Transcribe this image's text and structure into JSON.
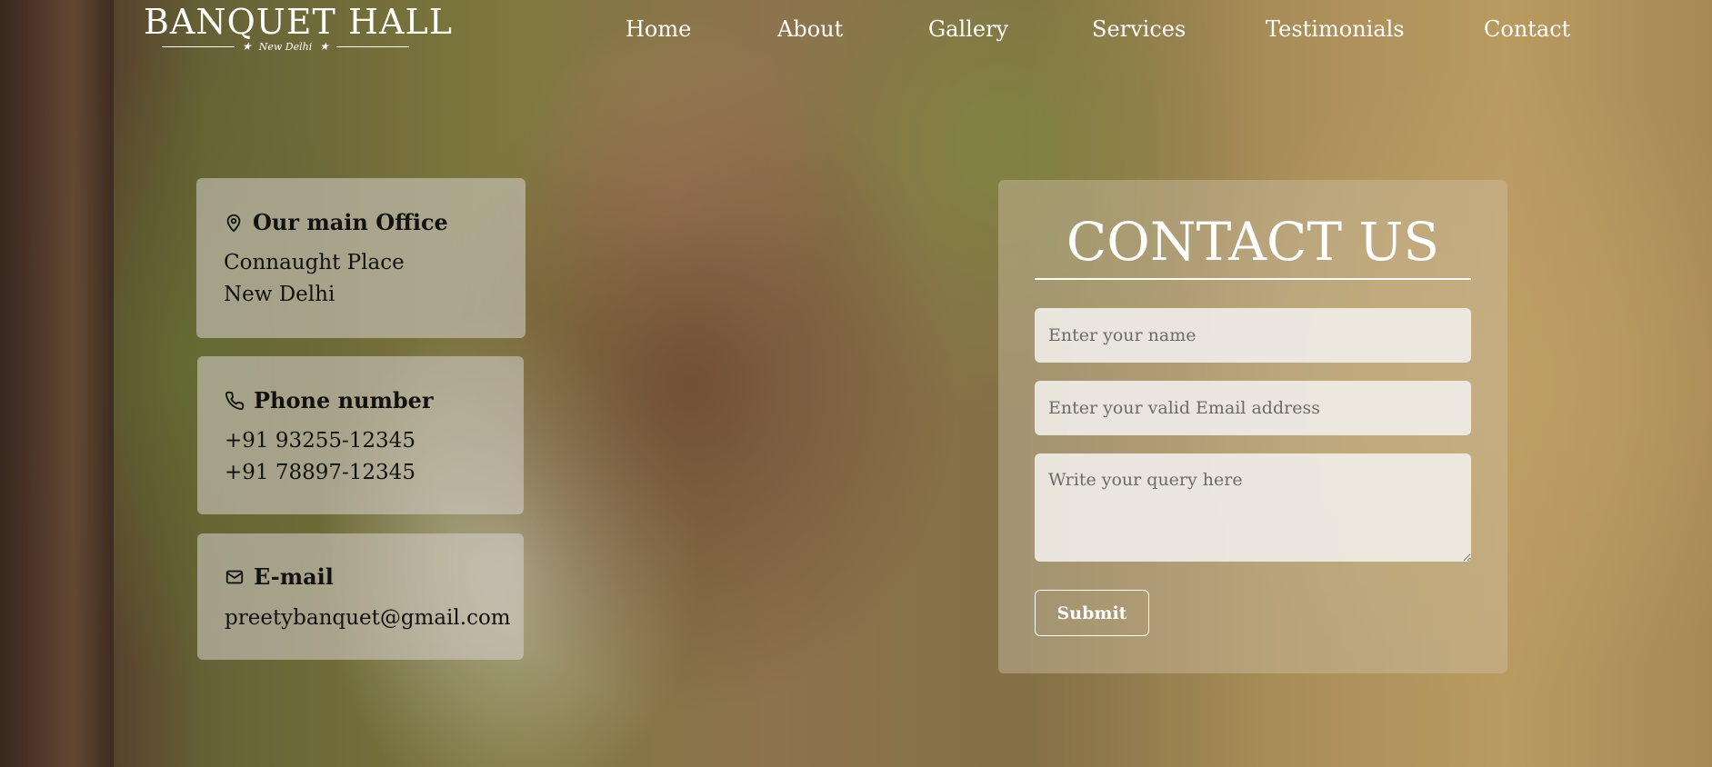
{
  "brand": {
    "title": "BANQUET HALL",
    "subtitle": "New Delhi"
  },
  "nav": {
    "items": [
      "Home",
      "About",
      "Gallery",
      "Services",
      "Testimonials",
      "Contact"
    ]
  },
  "office": {
    "heading": "Our main Office",
    "lines": [
      "Connaught Place",
      "New Delhi"
    ]
  },
  "phone": {
    "heading": "Phone number",
    "lines": [
      "+91 93255-12345",
      "+91 78897-12345"
    ]
  },
  "email": {
    "heading": "E-mail",
    "address": "preetybanquet@gmail.com"
  },
  "contact_form": {
    "title": "CONTACT US",
    "name_placeholder": "Enter your name",
    "email_placeholder": "Enter your valid Email address",
    "query_placeholder": "Write your query here",
    "submit_label": "Submit"
  },
  "icons": {
    "office": "map-pin-icon",
    "phone": "phone-icon",
    "email": "mail-icon",
    "logo_stars": "star-icon"
  },
  "colors": {
    "text_light": "#ffffff",
    "text_dark": "#111111"
  }
}
